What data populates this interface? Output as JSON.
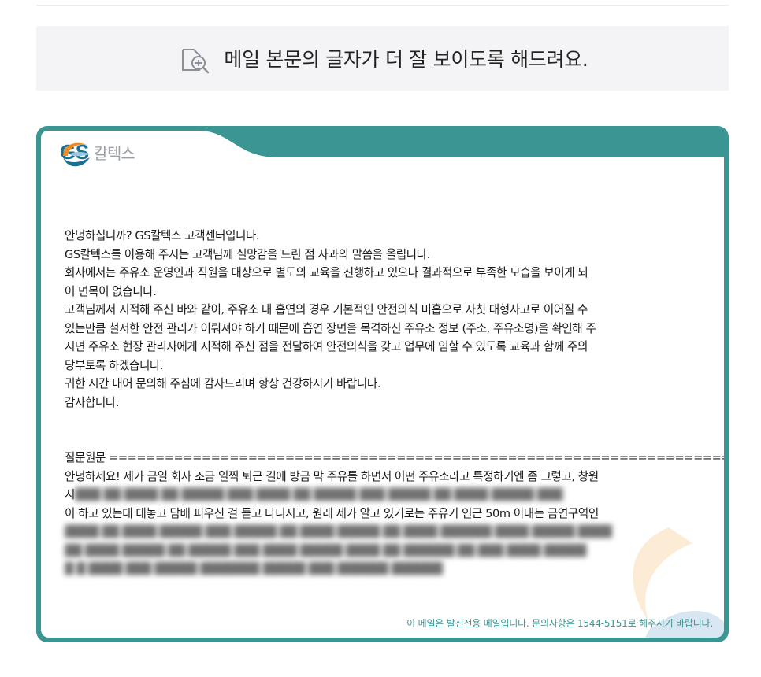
{
  "zoom_banner": {
    "label": "메일 본문의 글자가 더 잘 보이도록 해드려요.",
    "icon": "zoom-in-icon"
  },
  "mail": {
    "logo": {
      "brand": "GS",
      "brand_kr": "칼텍스"
    },
    "reply_lines": [
      "안녕하십니까? GS칼텍스 고객센터입니다.",
      "GS칼텍스를 이용해 주시는 고객님께 실망감을 드린 점 사과의 말씀을 올립니다.",
      "회사에서는 주유소 운영인과 직원을 대상으로 별도의 교육을 진행하고 있으나 결과적으로 부족한 모습을 보이게 되",
      "어 면목이 없습니다.",
      "고객님께서 지적해 주신 바와 같이, 주유소 내 흡연의 경우 기본적인 안전의식 미흡으로 자칫 대형사고로 이어질 수",
      "있는만큼 철저한 안전 관리가 이뤄져야 하기 때문에 흡연 장면을 목격하신 주유소 정보 (주소, 주유소명)을 확인해 주",
      "시면 주유소 현장 관리자에게 지적해 주신 점을 전달하여 안전의식을 갖고 업무에 임할 수 있도록 교육과 함께 주의",
      "당부토록 하겠습니다.",
      "귀한 시간 내어 문의해 주심에 감사드리며 항상 건강하시기 바랍니다.",
      "감사합니다."
    ],
    "question_header": "질문원문 ========================================================================",
    "question_lines": [
      "안녕하세요! 제가 금일 회사 조금 일찍 퇴근 길에 방금 막 주유를 하면서 어떤 주유소라고 특정하기엔 좀 그렇고, 창원",
      "시",
      "이 하고 있는데 대놓고 담배 피우신 걸 듣고 다니시고, 원래 제가 알고 있기로는 주유기 인근 50m 이내는 금연구역인"
    ],
    "footer_note": "이 메일은 발신전용 메일입니다. 문의사항은 1544-5151로 해주시기 바랍니다."
  },
  "colors": {
    "frame": "#3b9593",
    "brand_blue": "#1c6e94",
    "brand_orange": "#f28a1e",
    "banner_bg": "#f4f4f6"
  }
}
